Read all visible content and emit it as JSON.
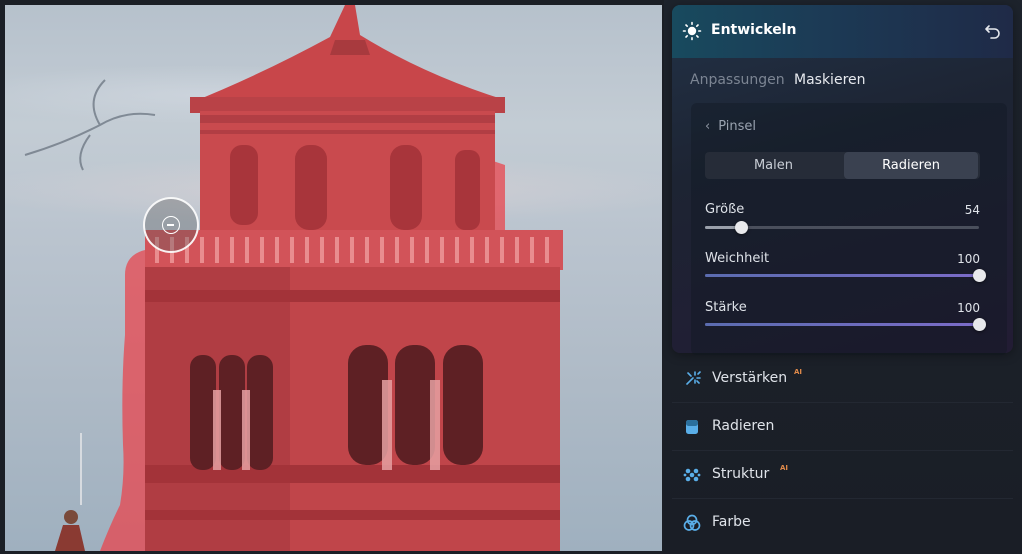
{
  "panel": {
    "title": "Entwickeln",
    "tabs": [
      {
        "label": "Anpassungen",
        "active": false
      },
      {
        "label": "Maskieren",
        "active": true
      }
    ],
    "brush": {
      "back_label": "Pinsel",
      "modes": [
        {
          "label": "Malen",
          "selected": false
        },
        {
          "label": "Radieren",
          "selected": true
        }
      ],
      "sliders": [
        {
          "label": "Größe",
          "value": "54",
          "fraction": 0.13
        },
        {
          "label": "Weichheit",
          "value": "100",
          "fraction": 1.0
        },
        {
          "label": "Stärke",
          "value": "100",
          "fraction": 1.0
        }
      ]
    },
    "tools": [
      {
        "label": "Verstärken",
        "badge": "AI",
        "icon": "sparkle-wand-icon"
      },
      {
        "label": "Radieren",
        "badge": "",
        "icon": "eraser-icon"
      },
      {
        "label": "Struktur",
        "badge": "AI",
        "icon": "dots-grid-icon"
      },
      {
        "label": "Farbe",
        "badge": "",
        "icon": "color-circles-icon"
      }
    ]
  },
  "colors": {
    "accent": "#5b6cb0",
    "mask_overlay": "#e8414b",
    "ai_badge": "#e08a4a",
    "icon_blue": "#5aaee8"
  }
}
